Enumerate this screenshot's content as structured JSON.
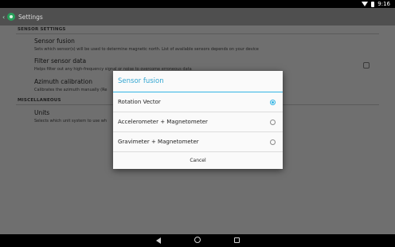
{
  "status_bar": {
    "time": "9:16"
  },
  "action_bar": {
    "title": "Settings"
  },
  "sections": [
    {
      "header": "SENSOR SETTINGS"
    },
    {
      "header": "MISCELLANEOUS"
    }
  ],
  "prefs": [
    {
      "title": "Sensor fusion",
      "summary": "Sets which sensor(s) will be used to determine magnetic north. List of available sensors depends on your device"
    },
    {
      "title": "Filter sensor data",
      "summary": "Helps filter out any high-frequency signal or noise to overcome erroneous data"
    },
    {
      "title": "Azimuth calibration",
      "summary": "Calibrates the azimuth manually (Re"
    },
    {
      "title": "Units",
      "summary": "Selects which unit system to use wh"
    }
  ],
  "dialog": {
    "title": "Sensor fusion",
    "options": [
      {
        "label": "Rotation Vector",
        "selected": true
      },
      {
        "label": "Accelerometer + Magnetometer",
        "selected": false
      },
      {
        "label": "Gravimeter + Magnetometer",
        "selected": false
      }
    ],
    "cancel": "Cancel"
  },
  "colors": {
    "accent": "#33b5e5",
    "app_icon": "#27a05a"
  }
}
